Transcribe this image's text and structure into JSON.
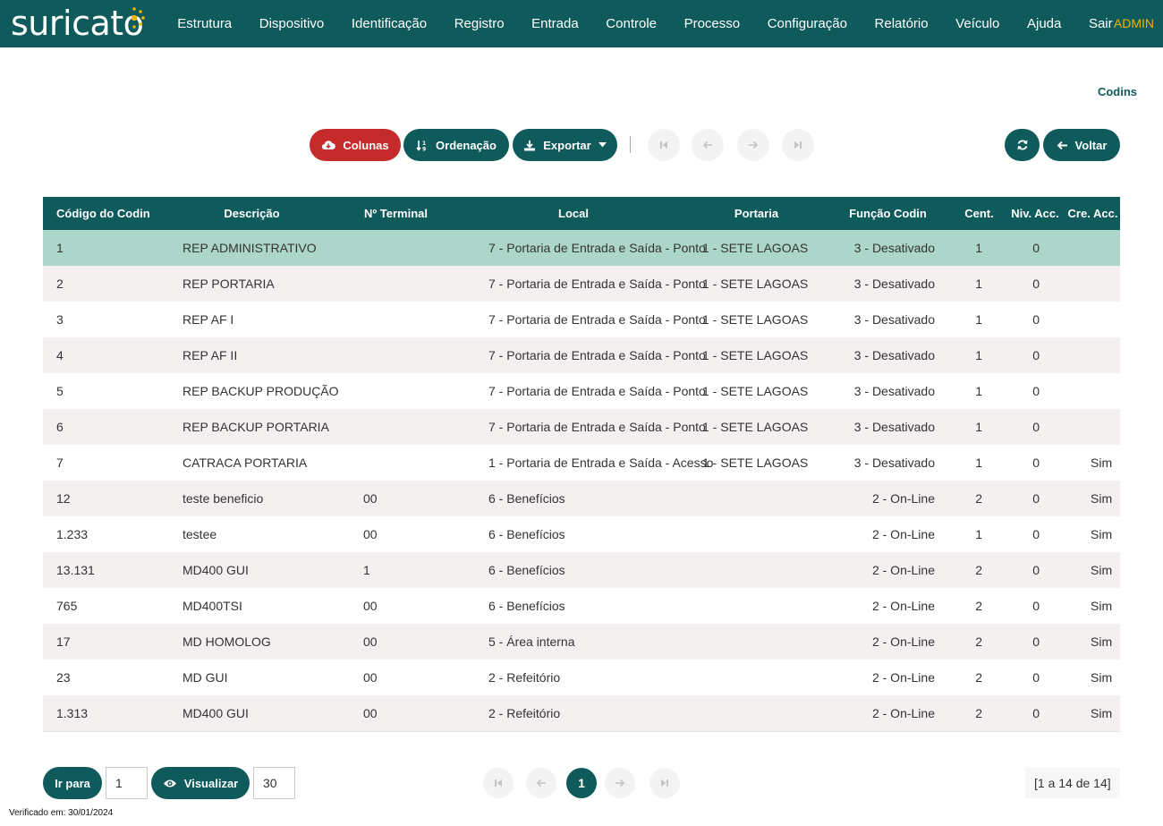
{
  "app": {
    "logo_text": "suricato",
    "user_label": "ADMIN"
  },
  "nav": {
    "items": [
      "Estrutura",
      "Dispositivo",
      "Identificação",
      "Registro",
      "Entrada",
      "Controle",
      "Processo",
      "Configuração",
      "Relatório",
      "Veículo",
      "Ajuda",
      "Sair"
    ]
  },
  "page": {
    "title": "Codins"
  },
  "toolbar": {
    "columns_label": "Colunas",
    "sort_label": "Ordenação",
    "export_label": "Exportar",
    "back_label": "Voltar"
  },
  "table": {
    "headers": [
      "Código do Codin",
      "Descrição",
      "Nº Terminal",
      "Local",
      "Portaria",
      "Função Codin",
      "Cent.",
      "Niv. Acc.",
      "Cre. Acc."
    ],
    "rows": [
      [
        "1",
        "REP ADMINISTRATIVO",
        "",
        "7 - Portaria de Entrada e Saída - Ponto",
        "1 - SETE LAGOAS",
        "3 - Desativado",
        "1",
        "0",
        ""
      ],
      [
        "2",
        "REP PORTARIA",
        "",
        "7 - Portaria de Entrada e Saída - Ponto",
        "1 - SETE LAGOAS",
        "3 - Desativado",
        "1",
        "0",
        ""
      ],
      [
        "3",
        "REP AF I",
        "",
        "7 - Portaria de Entrada e Saída - Ponto",
        "1 - SETE LAGOAS",
        "3 - Desativado",
        "1",
        "0",
        ""
      ],
      [
        "4",
        "REP AF II",
        "",
        "7 - Portaria de Entrada e Saída - Ponto",
        "1 - SETE LAGOAS",
        "3 - Desativado",
        "1",
        "0",
        ""
      ],
      [
        "5",
        "REP BACKUP PRODUÇÃO",
        "",
        "7 - Portaria de Entrada e Saída - Ponto",
        "1 - SETE LAGOAS",
        "3 - Desativado",
        "1",
        "0",
        ""
      ],
      [
        "6",
        "REP BACKUP PORTARIA",
        "",
        "7 - Portaria de Entrada e Saída - Ponto",
        "1 - SETE LAGOAS",
        "3 - Desativado",
        "1",
        "0",
        ""
      ],
      [
        "7",
        "CATRACA PORTARIA",
        "",
        "1 - Portaria de Entrada e Saída - Acesso",
        "1 - SETE LAGOAS",
        "3 - Desativado",
        "1",
        "0",
        "Sim"
      ],
      [
        "12",
        "teste beneficio",
        "00",
        "6 - Benefícios",
        "",
        "2 - On-Line",
        "2",
        "0",
        "Sim"
      ],
      [
        "1.233",
        "testee",
        "00",
        "6 - Benefícios",
        "",
        "2 - On-Line",
        "1",
        "0",
        "Sim"
      ],
      [
        "13.131",
        "MD400 GUI",
        "1",
        "6 - Benefícios",
        "",
        "2 - On-Line",
        "2",
        "0",
        "Sim"
      ],
      [
        "765",
        "MD400TSI",
        "00",
        "6 - Benefícios",
        "",
        "2 - On-Line",
        "2",
        "0",
        "Sim"
      ],
      [
        "17",
        "MD HOMOLOG",
        "00",
        "5 - Área interna",
        "",
        "2 - On-Line",
        "2",
        "0",
        "Sim"
      ],
      [
        "23",
        "MD GUI",
        "00",
        "2 - Refeitório",
        "",
        "2 - On-Line",
        "2",
        "0",
        "Sim"
      ],
      [
        "1.313",
        "MD400 GUI",
        "00",
        "2 - Refeitório",
        "",
        "2 - On-Line",
        "2",
        "0",
        "Sim"
      ]
    ],
    "selected_row": 0
  },
  "footer": {
    "goto_label": "Ir para",
    "goto_value": "1",
    "view_label": "Visualizar",
    "page_size": "30",
    "current_page": "1",
    "counter": "[1 a 14 de 14]",
    "verified": "Verificado em: 30/01/2024"
  },
  "colors": {
    "primary": "#0f5a5b",
    "danger": "#c62b2b",
    "accent": "#f0b400",
    "selected_row": "#acd6c9"
  }
}
